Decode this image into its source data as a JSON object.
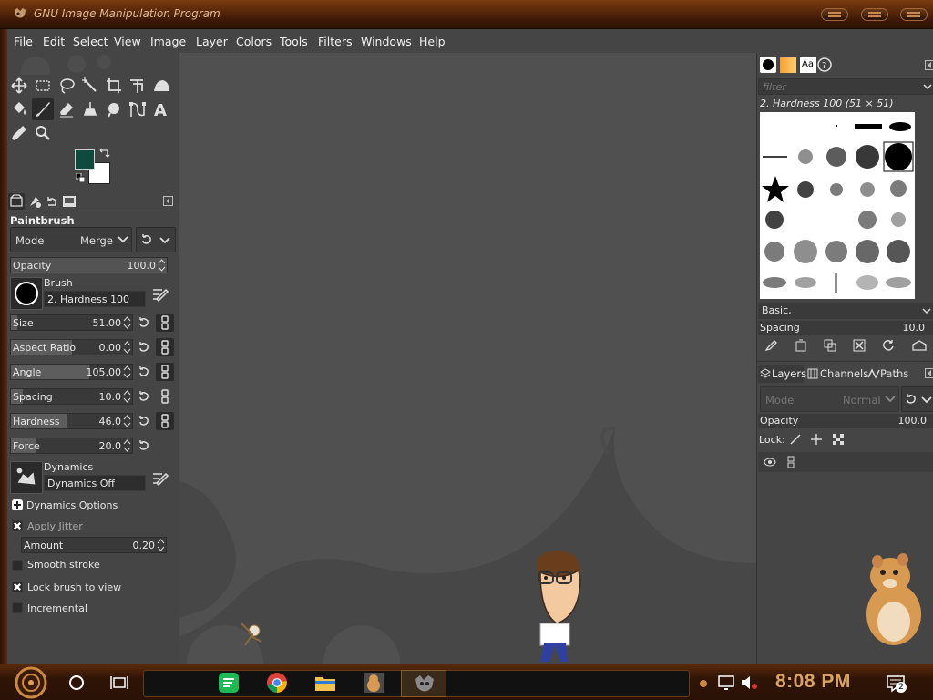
{
  "window": {
    "title": "GNU Image Manipulation Program"
  },
  "menu": [
    "File",
    "Edit",
    "Select",
    "View",
    "Image",
    "Layer",
    "Colors",
    "Tools",
    "Filters",
    "Windows",
    "Help"
  ],
  "colors": {
    "foreground": "#0e4a3e",
    "background": "#ffffff",
    "accent_frame": "#7a3b10",
    "clock": "#d8a460"
  },
  "tool_options": {
    "title": "Paintbrush",
    "mode_label": "Mode",
    "mode_value": "Merge",
    "opacity": {
      "label": "Opacity",
      "value": "100.0"
    },
    "brush": {
      "label": "Brush",
      "name": "2. Hardness 100"
    },
    "sliders": [
      {
        "label": "Size",
        "value": "51.00",
        "fill": 0.05
      },
      {
        "label": "Aspect Ratio",
        "value": "0.00",
        "fill": 0.5
      },
      {
        "label": "Angle",
        "value": "105.00",
        "fill": 0.65
      },
      {
        "label": "Spacing",
        "value": "10.0",
        "fill": 0.1
      },
      {
        "label": "Hardness",
        "value": "46.0",
        "fill": 0.46
      },
      {
        "label": "Force",
        "value": "20.0",
        "fill": 0.2
      }
    ],
    "dynamics": {
      "label": "Dynamics",
      "name": "Dynamics Off"
    },
    "dynamics_options": "Dynamics Options",
    "apply_jitter": "Apply Jitter",
    "amount": {
      "label": "Amount",
      "value": "0.20"
    },
    "smooth_stroke": "Smooth stroke",
    "lock_brush": "Lock brush to view",
    "incremental": "Incremental"
  },
  "brushes": {
    "filter_placeholder": "filter",
    "selected": "2. Hardness 100 (51 × 51)",
    "tag": "Basic,",
    "spacing_label": "Spacing",
    "spacing_value": "10.0"
  },
  "layers": {
    "tabs": [
      "Layers",
      "Channels",
      "Paths"
    ],
    "mode_label": "Mode",
    "mode_value": "Normal",
    "opacity_label": "Opacity",
    "opacity_value": "100.0",
    "lock_label": "Lock:"
  },
  "taskbar": {
    "clock": "8:08 PM",
    "notification_count": "2",
    "apps": [
      "spotify-icon",
      "chrome-icon",
      "file-explorer-icon",
      "hamster-app-icon",
      "gimp-icon"
    ]
  }
}
